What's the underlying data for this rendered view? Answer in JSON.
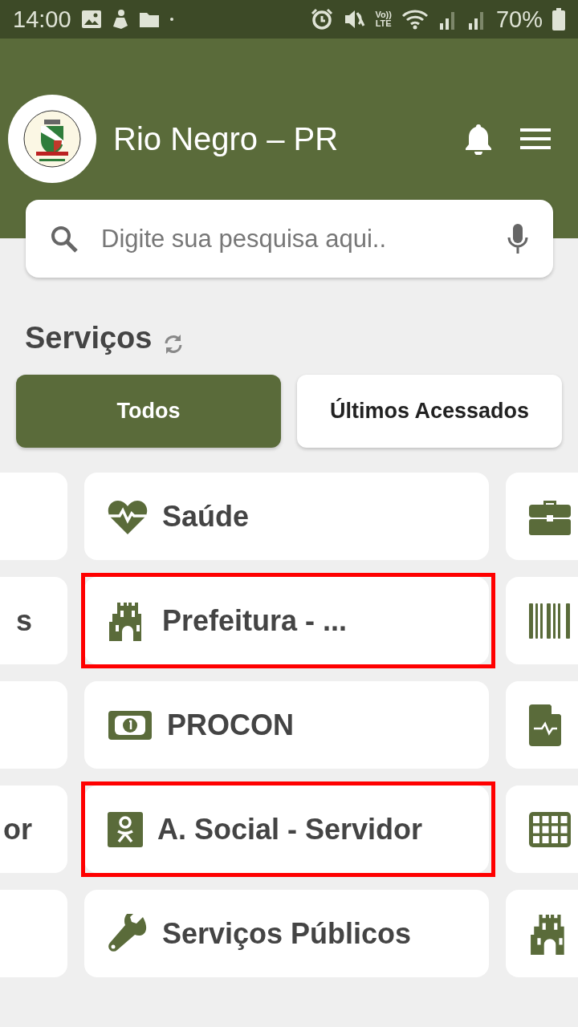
{
  "status_bar": {
    "time": "14:00",
    "volte_top": "Vo))",
    "volte_bottom": "LTE",
    "battery": "70%"
  },
  "header": {
    "title": "Rio Negro – PR"
  },
  "search": {
    "placeholder": "Digite sua pesquisa aqui.."
  },
  "section_title": "Serviços",
  "tabs": [
    {
      "label": "Todos",
      "selected": true
    },
    {
      "label": "Últimos Acessados",
      "selected": false
    }
  ],
  "services": [
    {
      "label": "Saúde",
      "highlighted": false
    },
    {
      "left_label": "s",
      "label": "Prefeitura - ...",
      "highlighted": true
    },
    {
      "label": "PROCON",
      "highlighted": false
    },
    {
      "left_label": "or",
      "label": "A. Social - Servidor",
      "highlighted": true
    },
    {
      "label": "Serviços Públicos",
      "highlighted": false
    }
  ]
}
